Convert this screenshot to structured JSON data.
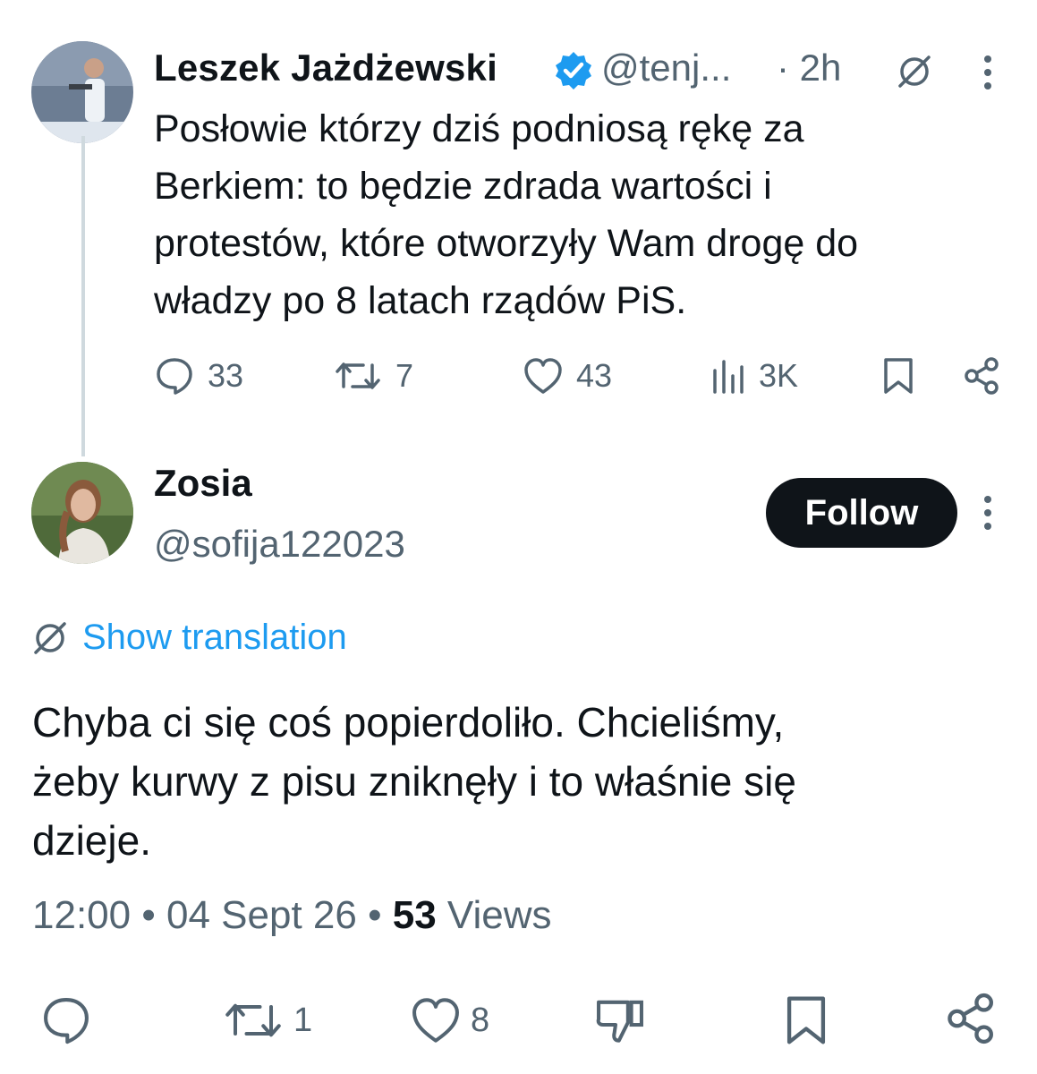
{
  "original_tweet": {
    "author_name": "Leszek Jażdżewski",
    "handle": "@tenj...",
    "time": "· 2h",
    "text": "Posłowie którzy dziś podniosą rękę za\nBerkiem: to będzie zdrada wartości i\nprotestów, które otworzyły Wam drogę do\nwładzy po 8 latach rządów PiS.",
    "actions": {
      "replies": "33",
      "reposts": "7",
      "likes": "43",
      "views": "3K"
    }
  },
  "reply_tweet": {
    "author_name": "Zosia",
    "handle": "@sofija122023",
    "follow_label": "Follow",
    "show_translation": "Show translation",
    "text": "Chyba ci się coś popierdoliło. Chcieliśmy,\nżeby kurwy z pisu zniknęły i to właśnie się\ndzieje.",
    "meta": {
      "time": "12:00",
      "date": "04 Sept 26",
      "views_count": "53",
      "views_label": "Views"
    },
    "actions": {
      "reposts": "1",
      "likes": "8"
    }
  },
  "colors": {
    "accent": "#1d9bf0",
    "text": "#0f1419",
    "muted": "#536471",
    "follow_bg": "#0f1419"
  },
  "icons": [
    "verified-badge-icon",
    "globe-icon",
    "more-icon",
    "reply-icon",
    "repost-icon",
    "like-icon",
    "views-icon",
    "bookmark-icon",
    "share-icon",
    "dislike-icon"
  ]
}
